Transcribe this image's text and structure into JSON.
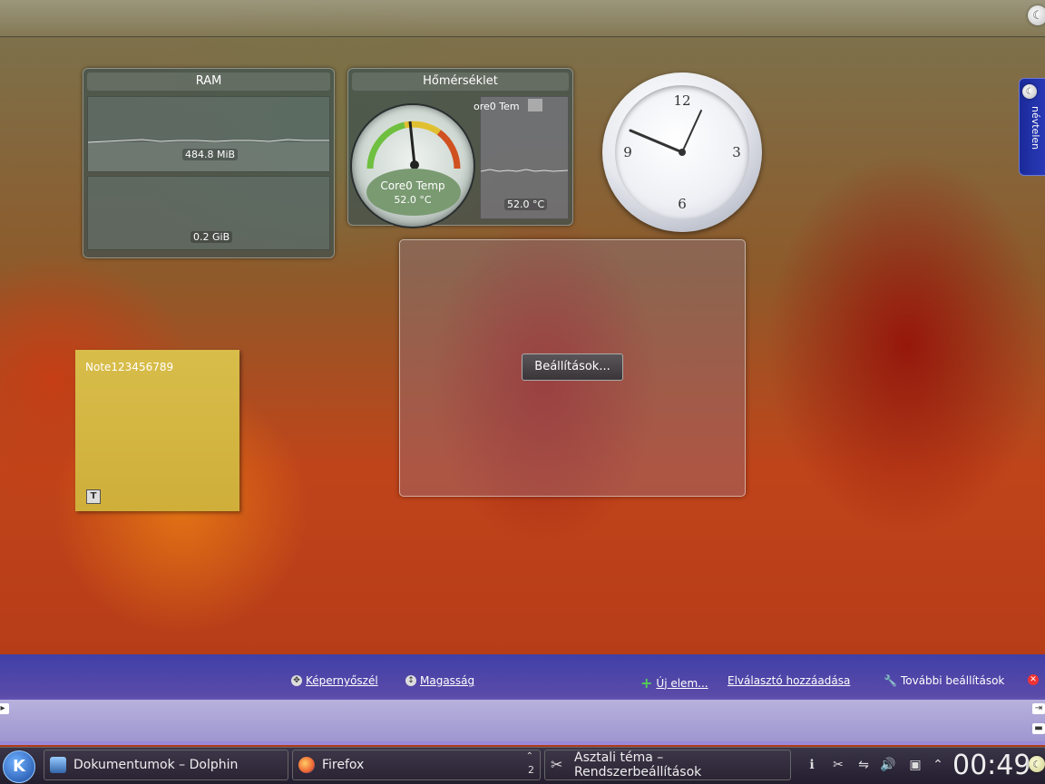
{
  "desktop": {
    "names_tab": "névtelen"
  },
  "ram_widget": {
    "title": "RAM",
    "value_upper": "484.8 MiB",
    "value_lower": "0.2 GiB"
  },
  "temp_widget": {
    "title": "Hőmérséklet",
    "gauge_label": "Core0 Temp",
    "gauge_value": "52.0 °C",
    "plot_label": "ore0 Tem",
    "plot_value": "52.0 °C"
  },
  "clock_widget": {
    "numerals": [
      "12",
      "3",
      "6",
      "9"
    ]
  },
  "configure_widget": {
    "button_label": "Beállítások..."
  },
  "note_widget": {
    "text": "Note123456789",
    "tool": "T"
  },
  "panel_controller": {
    "screen_edge": "Képernyőszél",
    "height": "Magasság",
    "new_widget": "Új elem...",
    "add_spacer": "Elválasztó hozzáadása",
    "more_settings": "További beállítások"
  },
  "taskbar": {
    "kmenu_label": "K",
    "tasks": [
      {
        "label": "Dokumentumok – Dolphin"
      },
      {
        "label": "Firefox"
      },
      {
        "label": "Asztali téma – Rendszerbeállítások"
      }
    ],
    "pager_number": "2",
    "clock": "00:49"
  },
  "colors": {
    "accent": "#3a3ab0",
    "note": "#d8bd4a"
  }
}
